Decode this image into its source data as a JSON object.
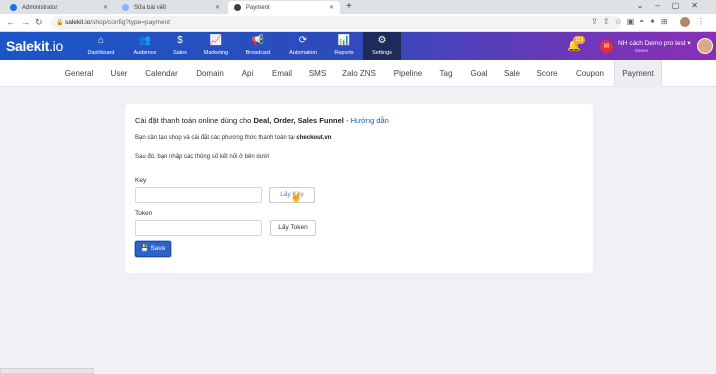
{
  "browser": {
    "tabs": [
      {
        "title": "Administrator",
        "icon_color": "#1a73e8"
      },
      {
        "title": "Sửa bài viết",
        "icon_color": "#5f6368"
      },
      {
        "title": "Payment",
        "icon_color": "#3c4043"
      }
    ],
    "new_tab": "+",
    "url_host": "salekit.io",
    "url_path": "/shop/config?type=payment"
  },
  "app": {
    "logo_main": "Salekit",
    "logo_suffix": ".io",
    "nav": [
      {
        "label": "Dashboard",
        "icon": "⌂"
      },
      {
        "label": "Audience",
        "icon": "👥"
      },
      {
        "label": "Sales",
        "icon": "$"
      },
      {
        "label": "Marketing",
        "icon": "📈"
      },
      {
        "label": "Broadcast",
        "icon": "📢"
      },
      {
        "label": "Automation",
        "icon": "⟳"
      },
      {
        "label": "Reports",
        "icon": "📊"
      },
      {
        "label": "Settings",
        "icon": "⚙"
      }
    ],
    "notification_count": "113",
    "user_name": "NH cách Demo pro test",
    "user_role": "Owner"
  },
  "subtabs": [
    "General",
    "User",
    "Calendar",
    "Domain",
    "Api",
    "Email",
    "SMS",
    "Zalo ZNS",
    "Pipeline",
    "Tag",
    "Goal",
    "Sale",
    "Score",
    "Coupon",
    "Payment"
  ],
  "form": {
    "headline_prefix": "Cài đặt thanh toán online dùng cho ",
    "headline_bold": "Deal, Order, Sales Funnel",
    "headline_sep": " - ",
    "headline_link": "Hướng dẫn",
    "line2_prefix": "Bạn cần tạo shop và cài đặt các phương thức thanh toán tại ",
    "line2_bold": "checkout.vn",
    "line3": "Sau đó, bạn nhập các thông số kết nối ở bên dưới",
    "key_label": "Key",
    "key_value": "",
    "get_key_button": "Lấy Key",
    "token_label": "Token",
    "token_value": "",
    "get_token_button": "Lấy Token",
    "save_button": "Save"
  },
  "colors": {
    "brand_blue": "#1a56c7",
    "brand_purple": "#8a2fb5",
    "save_button": "#2c63c7",
    "link": "#1d5fb8"
  }
}
